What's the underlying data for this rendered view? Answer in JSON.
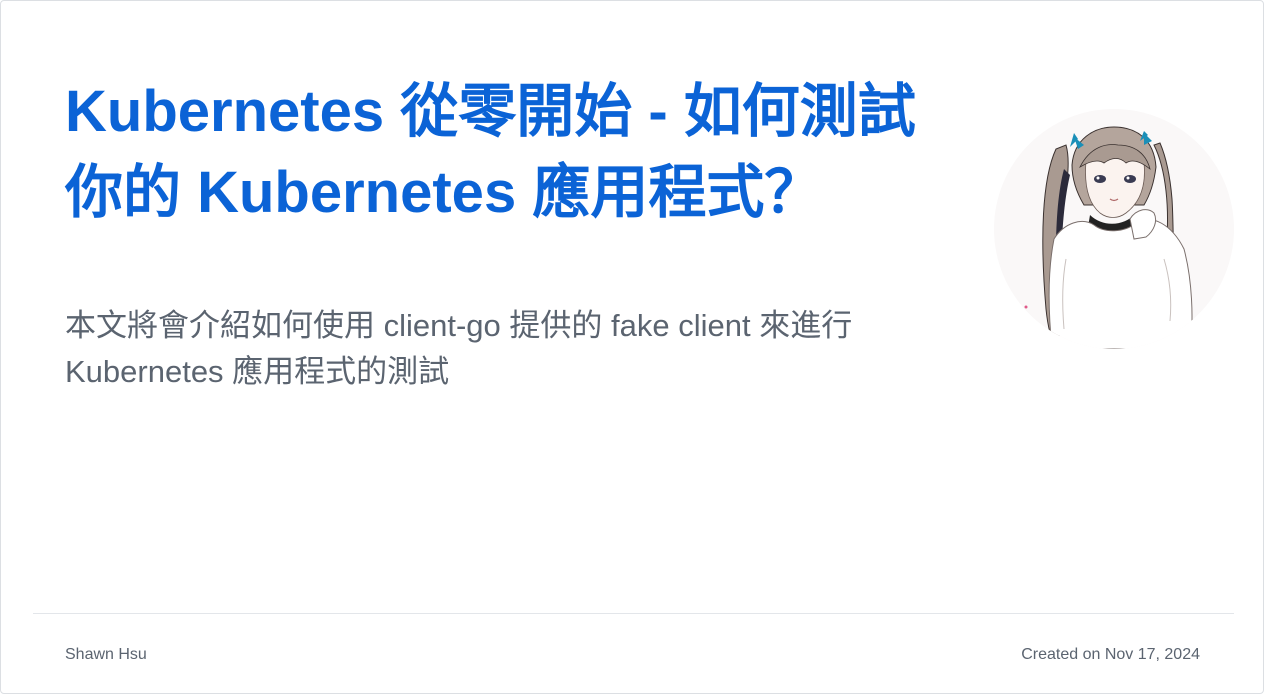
{
  "post": {
    "title": "Kubernetes 從零開始 - 如何測試你的 Kubernetes 應用程式？",
    "description": "本文將會介紹如何使用 client-go 提供的 fake client 來進行 Kubernetes 應用程式的測試",
    "avatar": "anime-girl-avatar-icon"
  },
  "footer": {
    "author": "Shawn Hsu",
    "date": "Created on Nov 17, 2024"
  },
  "colors": {
    "title": "#0b63d6",
    "text": "#5b6470",
    "border": "#dcdfe3"
  }
}
